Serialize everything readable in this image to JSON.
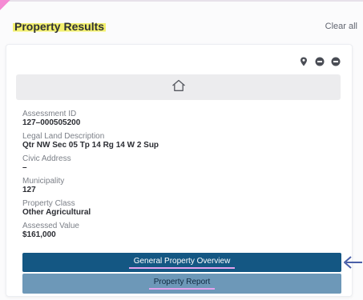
{
  "header": {
    "title": "Property Results",
    "clear_all": "Clear all"
  },
  "card": {
    "icons": [
      "map-pin-icon",
      "minus-circle-icon",
      "minus-circle-icon"
    ],
    "image_placeholder_icon": "home-icon",
    "fields": [
      {
        "label": "Assessment ID",
        "value": "127–000505200"
      },
      {
        "label": "Legal Land Description",
        "value": "Qtr NW Sec 05 Tp 14 Rg 14 W 2 Sup"
      },
      {
        "label": "Civic Address",
        "value": "–"
      },
      {
        "label": "Municipality",
        "value": "127"
      },
      {
        "label": "Property Class",
        "value": "Other Agricultural"
      },
      {
        "label": "Assessed Value",
        "value": "$161,000"
      }
    ],
    "buttons": {
      "primary": "General Property Overview",
      "secondary": "Property Report"
    }
  },
  "colors": {
    "primary_button": "#145783",
    "secondary_button": "#6d98b8",
    "title_highlight": "#f3f06e",
    "label_underline": "#e4a2ee",
    "arrow": "#4a5fa8"
  }
}
